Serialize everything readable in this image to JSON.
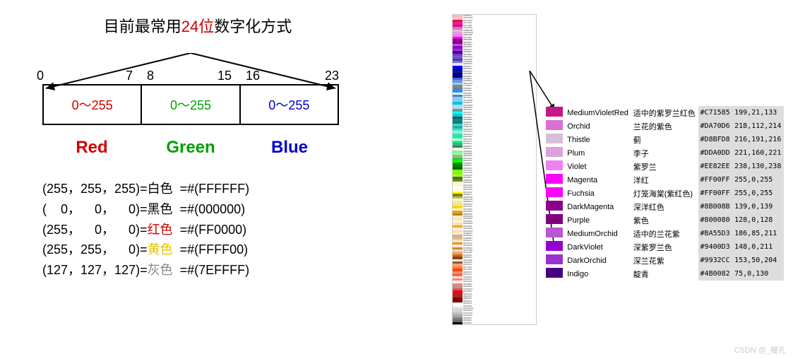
{
  "title": {
    "pre": "目前最常用",
    "bits": "24位",
    "post": "数字化方式"
  },
  "bitLabels": {
    "b0": "0",
    "b7": "7",
    "b8": "8",
    "b15": "15",
    "b16": "16",
    "b23": "23"
  },
  "bytes": {
    "r": "0～255",
    "g": "0～255",
    "b": "0～255"
  },
  "channels": {
    "r": "Red",
    "g": "Green",
    "b": "Blue"
  },
  "examples": [
    {
      "rgb": "(255，255，255)=",
      "name": "白色",
      "cls": "",
      "hex": "=#(FFFFFF)"
    },
    {
      "rgb": "(    0，    0，    0)=",
      "name": "黑色",
      "cls": "",
      "hex": "=#(000000)"
    },
    {
      "rgb": "(255，    0，    0)=",
      "name": "红色",
      "cls": "red-t",
      "hex": "=#(FF0000)"
    },
    {
      "rgb": "(255，255，    0)=",
      "name": "黄色",
      "cls": "yellow-t",
      "hex": "=#(FFFF00)"
    },
    {
      "rgb": "(127，127，127)=",
      "name": "灰色",
      "cls": "gray-t",
      "hex": "=#(7EFFFF)"
    }
  ],
  "colorDetail": [
    {
      "swatch": "#C71585",
      "en": "MediumVioletRed",
      "cn": "适中的紫罗兰红色",
      "hex": "#C71585",
      "dec": "199,21,133"
    },
    {
      "swatch": "#DA70D6",
      "en": "Orchid",
      "cn": "兰花的紫色",
      "hex": "#DA70D6",
      "dec": "218,112,214"
    },
    {
      "swatch": "#D8BFD8",
      "en": "Thistle",
      "cn": "蓟",
      "hex": "#D8BFD8",
      "dec": "216,191,216"
    },
    {
      "swatch": "#DDA0DD",
      "en": "Plum",
      "cn": "李子",
      "hex": "#DDA0DD",
      "dec": "221,160,221"
    },
    {
      "swatch": "#EE82EE",
      "en": "Violet",
      "cn": "紫罗兰",
      "hex": "#EE82EE",
      "dec": "238,130,238"
    },
    {
      "swatch": "#FF00FF",
      "en": "Magenta",
      "cn": "洋红",
      "hex": "#FF00FF",
      "dec": "255,0,255"
    },
    {
      "swatch": "#FF00FF",
      "en": "Fuchsia",
      "cn": "灯笼海棠(紫红色)",
      "hex": "#FF00FF",
      "dec": "255,0,255"
    },
    {
      "swatch": "#8B008B",
      "en": "DarkMagenta",
      "cn": "深洋红色",
      "hex": "#8B008B",
      "dec": "139,0,139"
    },
    {
      "swatch": "#800080",
      "en": "Purple",
      "cn": "紫色",
      "hex": "#800080",
      "dec": "128,0,128"
    },
    {
      "swatch": "#BA55D3",
      "en": "MediumOrchid",
      "cn": "适中的兰花紫",
      "hex": "#BA55D3",
      "dec": "186,85,211"
    },
    {
      "swatch": "#9400D3",
      "en": "DarkViolet",
      "cn": "深紫罗兰色",
      "hex": "#9400D3",
      "dec": "148,0,211"
    },
    {
      "swatch": "#9932CC",
      "en": "DarkOrchid",
      "cn": "深兰花紫",
      "hex": "#9932CC",
      "dec": "153,50,204"
    },
    {
      "swatch": "#4B0082",
      "en": "Indigo",
      "cn": "靛青",
      "hex": "#4B0082",
      "dec": "75,0,130"
    }
  ],
  "stripColors": [
    "#FFB6C1",
    "#FFC0CB",
    "#DC143C",
    "#FF1493",
    "#C71585",
    "#DA70D6",
    "#D8BFD8",
    "#DDA0DD",
    "#EE82EE",
    "#FF00FF",
    "#8B008B",
    "#800080",
    "#BA55D3",
    "#9400D3",
    "#9932CC",
    "#4B0082",
    "#8A2BE2",
    "#6A5ACD",
    "#483D8B",
    "#7B68EE",
    "#E6E6FA",
    "#0000FF",
    "#0000CD",
    "#191970",
    "#00008B",
    "#000080",
    "#4169E1",
    "#6495ED",
    "#B0C4DE",
    "#778899",
    "#708090",
    "#1E90FF",
    "#F0F8FF",
    "#4682B4",
    "#87CEFA",
    "#87CEEB",
    "#00BFFF",
    "#ADD8E6",
    "#B0E0E6",
    "#5F9EA0",
    "#00FFFF",
    "#00CED1",
    "#2F4F4F",
    "#008B8B",
    "#008080",
    "#48D1CC",
    "#20B2AA",
    "#40E0D0",
    "#7FFFD4",
    "#66CDAA",
    "#00FA9A",
    "#F5FFFA",
    "#00FF7F",
    "#3CB371",
    "#2E8B57",
    "#F0FFF0",
    "#90EE90",
    "#98FB98",
    "#8FBC8F",
    "#32CD32",
    "#00FF00",
    "#228B22",
    "#008000",
    "#006400",
    "#7FFF00",
    "#7CFC00",
    "#ADFF2F",
    "#556B2F",
    "#6B8E23",
    "#F5F5DC",
    "#FAFAD2",
    "#FFFFF0",
    "#FFFFE0",
    "#FFFF00",
    "#808000",
    "#BDB76B",
    "#FFFACD",
    "#EEE8AA",
    "#F0E68C",
    "#FFD700",
    "#FFF8DC",
    "#DAA520",
    "#B8860B",
    "#FFEBCD",
    "#FFE4B5",
    "#FDF5E6",
    "#F5DEB3",
    "#FFA500",
    "#FFEFD5",
    "#FFDEAD",
    "#FAEBD7",
    "#D2B48C",
    "#DEB887",
    "#FFE4C4",
    "#FF8C00",
    "#FAF0E6",
    "#CD853F",
    "#FFDAB9",
    "#F4A460",
    "#D2691E",
    "#8B4513",
    "#FFF5EE",
    "#A0522D",
    "#FFA07A",
    "#FF7F50",
    "#FF4500",
    "#E9967A",
    "#FF6347",
    "#FFE4E1",
    "#FA8072",
    "#FFFAFA",
    "#F08080",
    "#BC8F8F",
    "#CD5C5C",
    "#FF0000",
    "#A52A2A",
    "#B22222",
    "#8B0000",
    "#800000",
    "#FFFFFF",
    "#F5F5F5",
    "#DCDCDC",
    "#D3D3D3",
    "#C0C0C0",
    "#A9A9A9",
    "#808080",
    "#696969",
    "#000000"
  ],
  "watermark": "CSDN @_瞳孔"
}
